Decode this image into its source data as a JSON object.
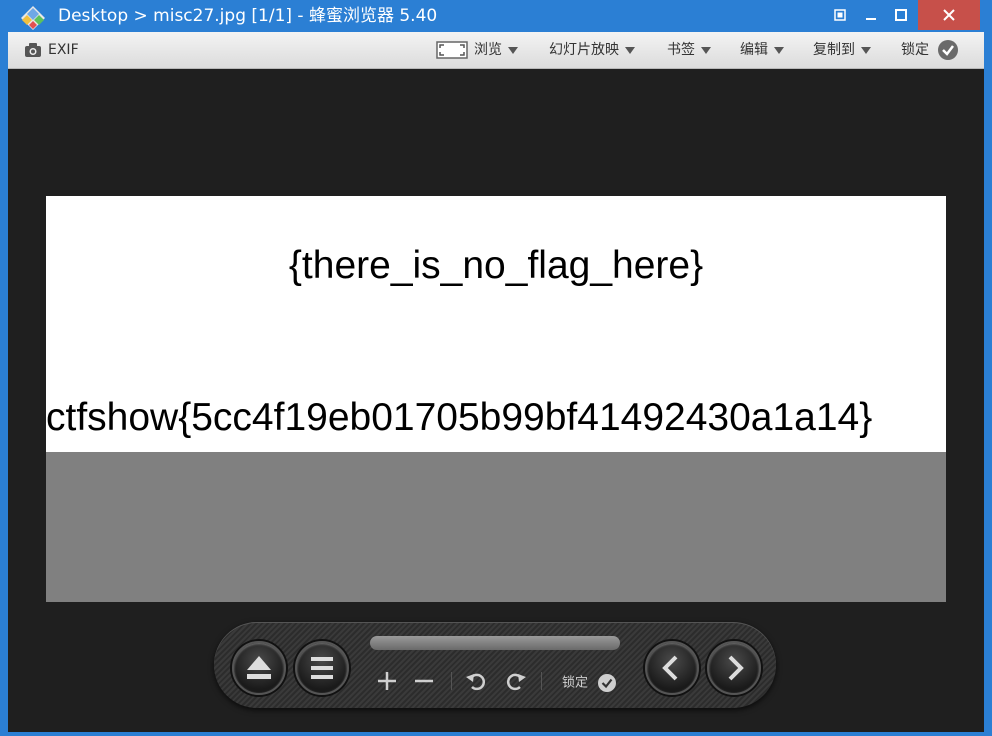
{
  "window": {
    "title": "Desktop > misc27.jpg [1/1] - 蜂蜜浏览器 5.40",
    "accent_color": "#2b7fd4",
    "close_color": "#c7504a",
    "buttons": [
      "restore-alt-icon",
      "minimize-icon",
      "maximize-icon",
      "close-icon"
    ]
  },
  "toolbar": {
    "exif_label": "EXIF",
    "browse_label": "浏览",
    "slideshow_label": "幻灯片放映",
    "bookmarks_label": "书签",
    "edit_label": "编辑",
    "copy_to_label": "复制到",
    "lock_label": "锁定"
  },
  "image": {
    "line1": "{there_is_no_flag_here}",
    "line2": "ctfshow{5cc4f19eb01705b99bf41492430a1a14}"
  },
  "controls": {
    "lock_label": "锁定",
    "icons": [
      "eject-icon",
      "menu-icon",
      "zoom-in-icon",
      "zoom-out-icon",
      "rotate-left-icon",
      "rotate-right-icon",
      "check-icon",
      "previous-icon",
      "next-icon"
    ]
  }
}
